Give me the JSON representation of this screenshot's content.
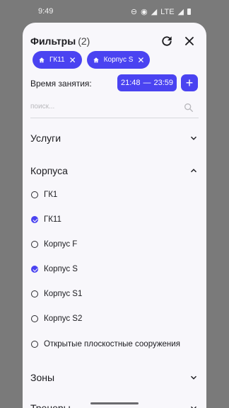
{
  "status_bar": {
    "time": "9:49",
    "network": "LTE"
  },
  "header": {
    "title": "Фильтры",
    "count": "(2)"
  },
  "chips": [
    {
      "label": "ГК11"
    },
    {
      "label": "Корпус S"
    }
  ],
  "time_filter": {
    "label": "Время занятия:",
    "start": "21:48",
    "dash": "—",
    "end": "23:59",
    "add": "+"
  },
  "search": {
    "placeholder": "поиск...",
    "value": ""
  },
  "sections": {
    "services": "Услуги",
    "buildings": "Корпуса",
    "zones": "Зоны",
    "trainers": "Тренеры"
  },
  "building_items": [
    {
      "label": "ГК1",
      "checked": false
    },
    {
      "label": "ГК11",
      "checked": true
    },
    {
      "label": "Корпус F",
      "checked": false
    },
    {
      "label": "Корпус S",
      "checked": true
    },
    {
      "label": "Корпус S1",
      "checked": false
    },
    {
      "label": "Корпус S2",
      "checked": false
    },
    {
      "label": "Открытые плоскостные сооружения",
      "checked": false
    }
  ],
  "accent_color": "#4a43f1"
}
